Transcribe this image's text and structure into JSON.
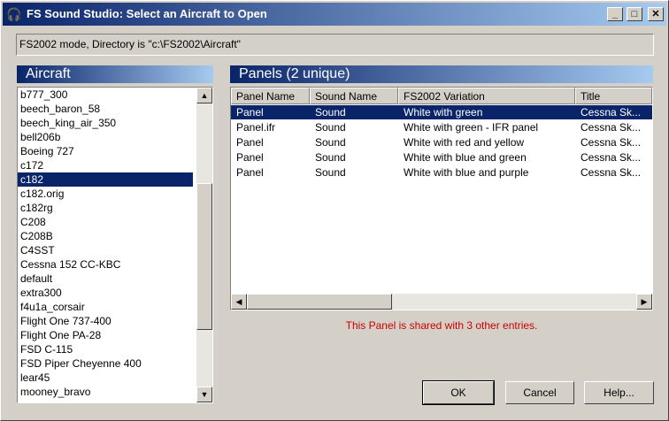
{
  "window": {
    "title": "FS Sound Studio: Select an Aircraft to Open",
    "icon": "headphones-icon",
    "controls": {
      "minimize": "_",
      "maximize": "□",
      "close": "✕"
    }
  },
  "status": {
    "text": "FS2002 mode, Directory is \"c:\\FS2002\\Aircraft\""
  },
  "aircraft": {
    "header": "Aircraft",
    "items": [
      "b777_300",
      "beech_baron_58",
      "beech_king_air_350",
      "bell206b",
      "Boeing 727",
      "c172",
      "c182",
      "c182.orig",
      "c182rg",
      "C208",
      "C208B",
      "C4SST",
      "Cessna 152 CC-KBC",
      "default",
      "extra300",
      "f4u1a_corsair",
      "Flight One 737-400",
      "Flight One PA-28",
      "FSD C-115",
      "FSD Piper Cheyenne 400",
      "lear45",
      "mooney_bravo"
    ],
    "selected_index": 6,
    "scroll": {
      "up": "▲",
      "down": "▼"
    }
  },
  "panels": {
    "header": "Panels  (2 unique)",
    "columns": [
      "Panel Name",
      "Sound Name",
      "FS2002 Variation",
      "Title"
    ],
    "rows": [
      [
        "Panel",
        "Sound",
        "White with green",
        "Cessna Sk..."
      ],
      [
        "Panel.ifr",
        "Sound",
        "White with green - IFR panel",
        "Cessna Sk..."
      ],
      [
        "Panel",
        "Sound",
        "White with red and yellow",
        "Cessna Sk..."
      ],
      [
        "Panel",
        "Sound",
        "White with blue and green",
        "Cessna Sk..."
      ],
      [
        "Panel",
        "Sound",
        "White with blue and purple",
        "Cessna Sk..."
      ]
    ],
    "selected_index": 0,
    "scroll": {
      "left": "◀",
      "right": "▶"
    },
    "shared_message": "This Panel is shared with 3 other entries."
  },
  "buttons": {
    "ok": "OK",
    "cancel": "Cancel",
    "help": "Help..."
  },
  "colors": {
    "title_gradient_start": "#0a246a",
    "title_gradient_end": "#a6caf0",
    "selection": "#0a246a",
    "message": "#cc0000"
  }
}
